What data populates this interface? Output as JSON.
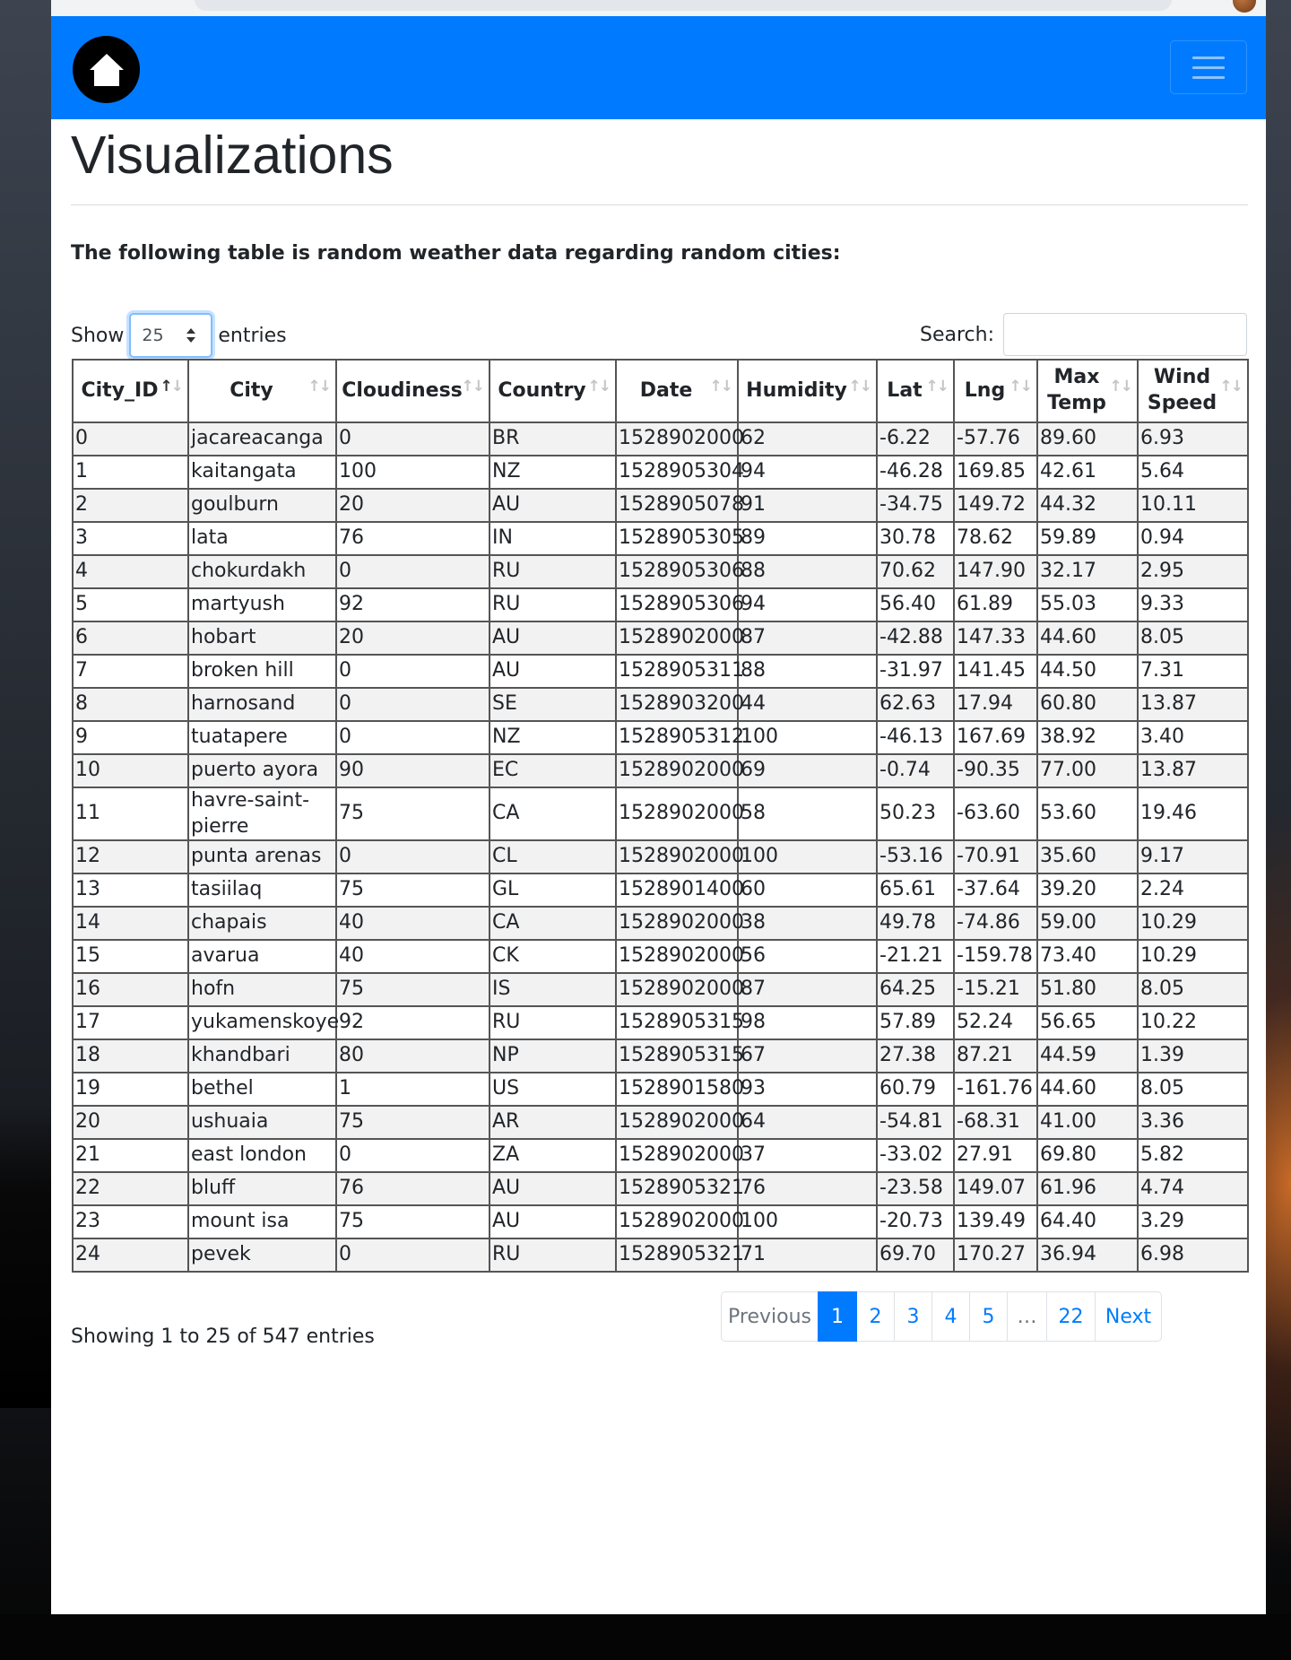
{
  "navbar": {
    "home_icon": "home-icon",
    "menu_icon": "hamburger-menu-icon"
  },
  "page": {
    "title": "Visualizations",
    "intro": "The following table is random weather data regarding random cities:"
  },
  "controls": {
    "show_label": "Show",
    "entries_value": "25",
    "entries_label": "entries",
    "search_label": "Search:",
    "search_value": ""
  },
  "table": {
    "columns": [
      "City_ID",
      "City",
      "Cloudiness",
      "Country",
      "Date",
      "Humidity",
      "Lat",
      "Lng",
      "Max Temp",
      "Wind Speed"
    ],
    "sorted_column": "City_ID",
    "rows": [
      [
        "0",
        "jacareacanga",
        "0",
        "BR",
        "1528902000",
        "62",
        "-6.22",
        "-57.76",
        "89.60",
        "6.93"
      ],
      [
        "1",
        "kaitangata",
        "100",
        "NZ",
        "1528905304",
        "94",
        "-46.28",
        "169.85",
        "42.61",
        "5.64"
      ],
      [
        "2",
        "goulburn",
        "20",
        "AU",
        "1528905078",
        "91",
        "-34.75",
        "149.72",
        "44.32",
        "10.11"
      ],
      [
        "3",
        "lata",
        "76",
        "IN",
        "1528905305",
        "89",
        "30.78",
        "78.62",
        "59.89",
        "0.94"
      ],
      [
        "4",
        "chokurdakh",
        "0",
        "RU",
        "1528905306",
        "88",
        "70.62",
        "147.90",
        "32.17",
        "2.95"
      ],
      [
        "5",
        "martyush",
        "92",
        "RU",
        "1528905306",
        "94",
        "56.40",
        "61.89",
        "55.03",
        "9.33"
      ],
      [
        "6",
        "hobart",
        "20",
        "AU",
        "1528902000",
        "87",
        "-42.88",
        "147.33",
        "44.60",
        "8.05"
      ],
      [
        "7",
        "broken hill",
        "0",
        "AU",
        "1528905311",
        "88",
        "-31.97",
        "141.45",
        "44.50",
        "7.31"
      ],
      [
        "8",
        "harnosand",
        "0",
        "SE",
        "1528903200",
        "44",
        "62.63",
        "17.94",
        "60.80",
        "13.87"
      ],
      [
        "9",
        "tuatapere",
        "0",
        "NZ",
        "1528905312",
        "100",
        "-46.13",
        "167.69",
        "38.92",
        "3.40"
      ],
      [
        "10",
        "puerto ayora",
        "90",
        "EC",
        "1528902000",
        "69",
        "-0.74",
        "-90.35",
        "77.00",
        "13.87"
      ],
      [
        "11",
        "havre-saint-pierre",
        "75",
        "CA",
        "1528902000",
        "58",
        "50.23",
        "-63.60",
        "53.60",
        "19.46"
      ],
      [
        "12",
        "punta arenas",
        "0",
        "CL",
        "1528902000",
        "100",
        "-53.16",
        "-70.91",
        "35.60",
        "9.17"
      ],
      [
        "13",
        "tasiilaq",
        "75",
        "GL",
        "1528901400",
        "60",
        "65.61",
        "-37.64",
        "39.20",
        "2.24"
      ],
      [
        "14",
        "chapais",
        "40",
        "CA",
        "1528902000",
        "38",
        "49.78",
        "-74.86",
        "59.00",
        "10.29"
      ],
      [
        "15",
        "avarua",
        "40",
        "CK",
        "1528902000",
        "56",
        "-21.21",
        "-159.78",
        "73.40",
        "10.29"
      ],
      [
        "16",
        "hofn",
        "75",
        "IS",
        "1528902000",
        "87",
        "64.25",
        "-15.21",
        "51.80",
        "8.05"
      ],
      [
        "17",
        "yukamenskoye",
        "92",
        "RU",
        "1528905315",
        "98",
        "57.89",
        "52.24",
        "56.65",
        "10.22"
      ],
      [
        "18",
        "khandbari",
        "80",
        "NP",
        "1528905315",
        "67",
        "27.38",
        "87.21",
        "44.59",
        "1.39"
      ],
      [
        "19",
        "bethel",
        "1",
        "US",
        "1528901580",
        "93",
        "60.79",
        "-161.76",
        "44.60",
        "8.05"
      ],
      [
        "20",
        "ushuaia",
        "75",
        "AR",
        "1528902000",
        "64",
        "-54.81",
        "-68.31",
        "41.00",
        "3.36"
      ],
      [
        "21",
        "east london",
        "0",
        "ZA",
        "1528902000",
        "37",
        "-33.02",
        "27.91",
        "69.80",
        "5.82"
      ],
      [
        "22",
        "bluff",
        "76",
        "AU",
        "1528905321",
        "76",
        "-23.58",
        "149.07",
        "61.96",
        "4.74"
      ],
      [
        "23",
        "mount isa",
        "75",
        "AU",
        "1528902000",
        "100",
        "-20.73",
        "139.49",
        "64.40",
        "3.29"
      ],
      [
        "24",
        "pevek",
        "0",
        "RU",
        "1528905321",
        "71",
        "69.70",
        "170.27",
        "36.94",
        "6.98"
      ]
    ]
  },
  "footer": {
    "info": "Showing 1 to 25 of 547 entries",
    "pagination": [
      "Previous",
      "1",
      "2",
      "3",
      "4",
      "5",
      "…",
      "22",
      "Next"
    ],
    "active_page": "1"
  },
  "colors": {
    "primary": "#007bff",
    "text": "#212529",
    "stripe": "#f2f2f2"
  }
}
